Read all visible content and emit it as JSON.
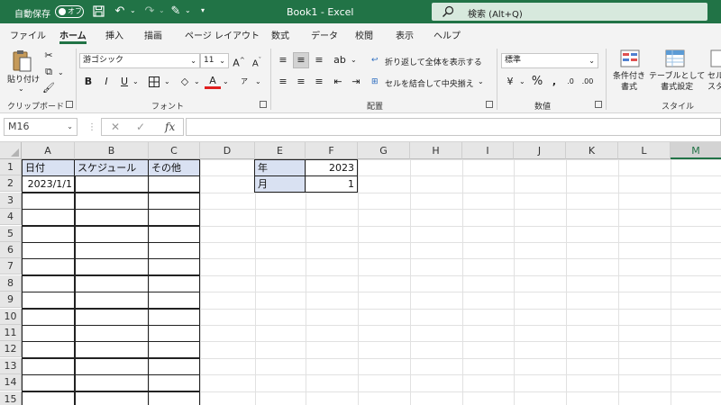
{
  "titlebar": {
    "autosave_label": "自動保存",
    "autosave_state": "オフ",
    "doc_title": "Book1  -  Excel",
    "search_text": "検索 (Alt+Q)"
  },
  "menu": {
    "tabs": [
      "ファイル",
      "ホーム",
      "挿入",
      "描画",
      "ページ レイアウト",
      "数式",
      "データ",
      "校閲",
      "表示",
      "ヘルプ"
    ],
    "active": "ホーム"
  },
  "ribbon": {
    "clipboard": {
      "paste_label": "貼り付け",
      "group_label": "クリップボード"
    },
    "font": {
      "font_name": "游ゴシック",
      "font_size": "11",
      "group_label": "フォント",
      "phonetic": "ア"
    },
    "alignment": {
      "wrap_text": "折り返して全体を表示する",
      "merge_center": "セルを結合して中央揃え",
      "group_label": "配置"
    },
    "number": {
      "format": "標準",
      "group_label": "数値"
    },
    "styles": {
      "conditional": "条件付き\n書式",
      "table": "テーブルとして\n書式設定",
      "cell_styles": "セル\nスタイル",
      "group_label": "スタイル"
    }
  },
  "formula_bar": {
    "name_box": "M16",
    "fx": "fx",
    "formula": ""
  },
  "sheet": {
    "columns": [
      "A",
      "B",
      "C",
      "D",
      "E",
      "F",
      "G",
      "H",
      "I",
      "J",
      "K",
      "L",
      "M"
    ],
    "selected_column": "M",
    "rows": [
      "1",
      "2",
      "3",
      "4",
      "5",
      "6",
      "7",
      "8",
      "9",
      "10",
      "11",
      "12",
      "13",
      "14",
      "15"
    ],
    "cells": {
      "A1": "日付",
      "B1": "スケジュール",
      "C1": "その他",
      "A2": "2023/1/1",
      "E1": "年",
      "F1": "2023",
      "E2": "月",
      "F2": "1"
    }
  }
}
